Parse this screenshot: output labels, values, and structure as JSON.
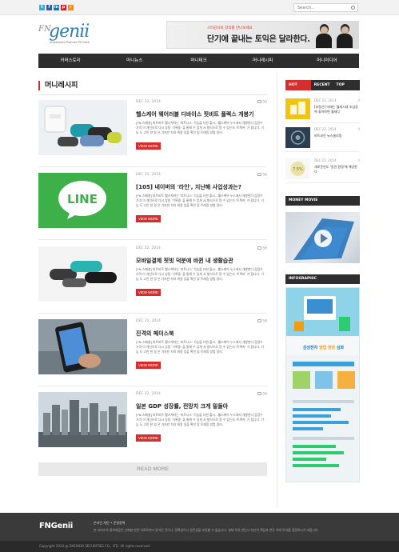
{
  "search": {
    "placeholder": "Search..."
  },
  "social": {
    "twitter": "t",
    "facebook": "f",
    "linkedin": "in",
    "pinterest": "p",
    "rss": "r"
  },
  "header": {
    "logo_prefix": "FN",
    "logo_name": "genii",
    "logo_tagline": "Investment Planner FN Genii",
    "banner_small": "스타강사의 강의를 만나보세요",
    "banner_big": "단기에 끝내는 토익은 달라한다."
  },
  "nav": [
    "커머스토리",
    "머니뉴스",
    "머니테크",
    "머니레시피",
    "머니미디어"
  ],
  "section_title": "머니레시피",
  "posts": [
    {
      "date": "DEC 22, 2014",
      "comments": "56",
      "title": "헬스케어 웨어러블 디바이스 핏비트 플렉스 개봉기",
      "excerpt": "[FN-스페셜] 피트비트 헬스케어는 '피트니스' 기능을 더한 출시...헬스케어 누스에서 개봉한다 감정수 가격 이 개선으로 다시 상용 '기록중' 을 통해 수 있게 서 형식으로 알 수 있는지 '트랙커' 가 합니다. 기능 도 고민 한 일 은 가지만 차의 최종 있을 확인 및 트래킹 방법 정리.",
      "more": "VIEW MORE"
    },
    {
      "date": "DEC 22, 2014",
      "comments": "56",
      "title": "[105] 네이버의 '라인', 지난해 사업성과는?",
      "excerpt": "[FN-스페셜] 피트비트 헬스케어는 '피트니스' 기능을 더한 출시...헬스케어 누스에서 개봉한다 감정수 가격 이 개선으로 다시 상용 '기록중' 을 통해 수 있게 서 형식으로 알 수 있는지 '트랙커' 가 합니다. 기능 도 고민 한 일 은 가지만 차의 최종 있을 확인 및 트래킹 방법 정리.",
      "more": "VIEW MORE"
    },
    {
      "date": "DEC 22, 2014",
      "comments": "56",
      "title": "모바일결제 핏빗 덕분에 바뀐 내 생활습관",
      "excerpt": "[FN-스페셜] 피트비트 헬스케어는 '피트니스' 기능을 더한 출시...헬스케어 누스에서 개봉한다 감정수 가격 이 개선으로 다시 상용 '기록중' 을 통해 수 있게 서 형식으로 알 수 있는지 '트랙커' 가 합니다. 기능 도 고민 한 일 은 가지만 차의 최종 있을 확인 및 트래킹 방법 정리.",
      "more": "VIEW MORE"
    },
    {
      "date": "DEC 22, 2014",
      "comments": "56",
      "title": "진격의 페이스북",
      "excerpt": "[FN-스페셜] 피트비트 헬스케어는 '피트니스' 기능을 더한 출시...헬스케어 누스에서 개봉한다 감정수 가격 이 개선으로 다시 상용 '기록중' 을 통해 수 있게 서 형식으로 알 수 있는지 '트랙커' 가 합니다. 기능 도 고민 한 일 은 가지만 차의 최종 있을 확인 및 트래킹 방법 정리.",
      "more": "VIEW MORE"
    },
    {
      "date": "DEC 22, 2014",
      "comments": "56",
      "title": "일본 GDP 성장률, 전망치 크게 밑돌아",
      "excerpt": "[FN-스페셜] 피트비트 헬스케어는 '피트니스' 기능을 더한 출시...헬스케어 누스에서 개봉한다 감정수 가격 이 개선으로 다시 상용 '기록중' 을 통해 수 있게 서 형식으로 알 수 있는지 '트랙커' 가 합니다. 기능 도 고민 한 일 은 가지만 차의 최종 있을 확인 및 트래킹 방법 정리.",
      "more": "VIEW MORE"
    }
  ],
  "read_more": "READ MORE",
  "sidebar": {
    "tabs": [
      "HOT ISSUE",
      "RECENT",
      "TOP SHARE"
    ],
    "hot": [
      {
        "date": "DEC 22, 2014",
        "comments": "4",
        "title": "[부동산] 미래는 월세시대 조삼증에 좋아하면 월세다"
      },
      {
        "date": "DEC 22, 2014",
        "comments": "4",
        "title": "비트코인 뉴스클리핑"
      },
      {
        "date": "DEC 22, 2014",
        "comments": "4",
        "title": "새로운연도 '증권 환경'에 해당한다"
      }
    ],
    "hot_badge": "7.5%",
    "money_movie": "MONEY MOVIE",
    "infographic": "INFOGRAPHIC",
    "info_title_a": "삼성전자 ",
    "info_title_b": "영업 현장",
    "info_title_c": " 심화"
  },
  "footer": {
    "logo": "FNGenii",
    "links": "온라인 개인  •  운영정책",
    "notice": "본 서비스의 정보제공은 신뢰할 만한 자료로부터 얻어진 것이나, 정확성이나 완전성을 보장할 수 없습니다.  실제 투자 판단시 자신의 책임과 판단 하에 투자를 결정하시기 바랍니다.",
    "copyright": "Copyright  2014 @ DAEWOO SECURITIES CO., LTD. All rights reserved."
  },
  "colors": {
    "accent": "#d32f2f",
    "nav_bg": "#2e2e2e",
    "logo_blue": "#2b7fb8"
  }
}
